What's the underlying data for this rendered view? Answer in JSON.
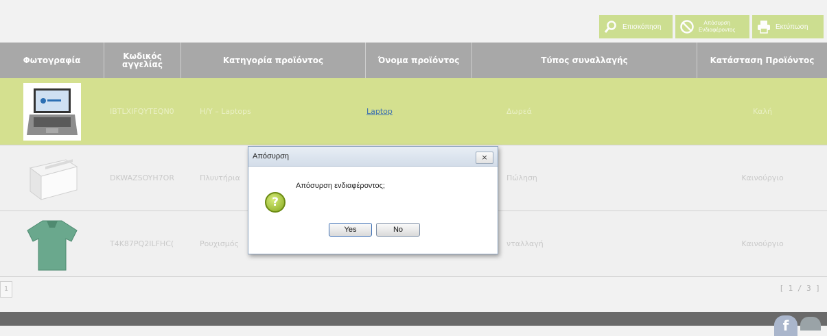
{
  "toolbar": {
    "overview_label": "Επισκόπηση",
    "withdraw_label_1": "Απόσυρση",
    "withdraw_label_2": "Ενδιαφέροντος",
    "print_label": "Εκτύπωση"
  },
  "table": {
    "headers": [
      "Φωτογραφία",
      "Κωδικός αγγελίας",
      "Κατηγορία προϊόντος",
      "Όνομα προϊόντος",
      "Τύπος συναλλαγής",
      "Κατάσταση Προϊόντος"
    ],
    "rows": [
      {
        "code": "IBTLXIFQYTEQN0",
        "category": "Η/Υ – Laptops",
        "name": "Laptop",
        "type": "Δωρεά",
        "condition": "Καλή",
        "thumb_icon": "laptop-photo"
      },
      {
        "code": "DKWAZSOYH7OR",
        "category": "Πλυντήρια",
        "name": "",
        "type": "Πώληση",
        "condition": "Καινούργιο",
        "thumb_icon": "dishwasher-photo"
      },
      {
        "code": "T4K87PQ2ILFHC(",
        "category": "Ρουχισμός",
        "name": "",
        "type": "νταλλαγή",
        "condition": "Καινούργιο",
        "thumb_icon": "tshirt-photo"
      }
    ]
  },
  "pager": {
    "left_label": "1",
    "page_indicator": "[ 1 / 3 ]"
  },
  "dialog": {
    "title": "Απόσυρση",
    "close_label": "×",
    "message": "Απόσυρση ενδιαφέροντος;",
    "icon_glyph": "?",
    "yes_label": "Yes",
    "no_label": "No"
  },
  "footer": {
    "facebook_glyph": "f"
  },
  "colors": {
    "accent": "#c6db7f",
    "header": "#a8a8a8",
    "selected_row": "#d4e08f"
  }
}
